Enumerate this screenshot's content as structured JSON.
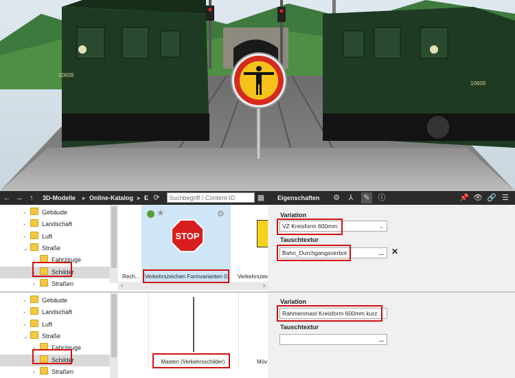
{
  "toolbar": {
    "back": "←",
    "forward": "→",
    "up": "↑",
    "crumb1": "3D-Modelle",
    "crumb2": "Online-Katalog",
    "crumb3": "E",
    "search_placeholder": "Suchbegriff / Content-ID",
    "properties_title": "Eigenschaften"
  },
  "tree_top": [
    {
      "label": "Gebäude",
      "expanded": false,
      "level": 0
    },
    {
      "label": "Landschaft",
      "expanded": false,
      "level": 0
    },
    {
      "label": "Luft",
      "expanded": false,
      "level": 0
    },
    {
      "label": "Straße",
      "expanded": true,
      "level": 0
    },
    {
      "label": "Fahrzeuge",
      "expanded": false,
      "level": 1
    },
    {
      "label": "Schilder",
      "expanded": false,
      "level": 1,
      "selected": true
    },
    {
      "label": "Straßen",
      "expanded": false,
      "level": 1
    }
  ],
  "tree_bottom": [
    {
      "label": "Gebäude",
      "expanded": false,
      "level": 0
    },
    {
      "label": "Landschaft",
      "expanded": false,
      "level": 0
    },
    {
      "label": "Luft",
      "expanded": false,
      "level": 0
    },
    {
      "label": "Straße",
      "expanded": true,
      "level": 0
    },
    {
      "label": "Fahrzeuge",
      "expanded": false,
      "level": 1
    },
    {
      "label": "Schilder",
      "expanded": false,
      "level": 1,
      "selected": true
    },
    {
      "label": "Straßen",
      "expanded": false,
      "level": 1
    }
  ],
  "thumbs_top": {
    "left_label": "Rech...",
    "main_label": "Verkehrszeichen Formvarianten 01",
    "right_label": "Verkehrszeich"
  },
  "thumbs_bottom": {
    "main_label": "Masten (Verkehrsschilder)",
    "right_label": "Möv"
  },
  "props_top": {
    "variation_label": "Variation",
    "variation_value": "VZ Kreisform 600mm",
    "texture_label": "Tauschtextur",
    "texture_value": "Bahn_Durchgangsverbot",
    "more": "...",
    "clear": "✕"
  },
  "props_bottom": {
    "variation_label": "Variation",
    "variation_value": "Rahmenmast Kreisform 600mm kurz",
    "texture_label": "Tauschtextur",
    "texture_value": "",
    "more": "..."
  },
  "sign_text": "STOP",
  "loco_number": "10609",
  "colors": {
    "highlight": "#d01010",
    "toolbar": "#2b2b2b",
    "loco": "#1e3a22",
    "folder": "#f4c842"
  }
}
